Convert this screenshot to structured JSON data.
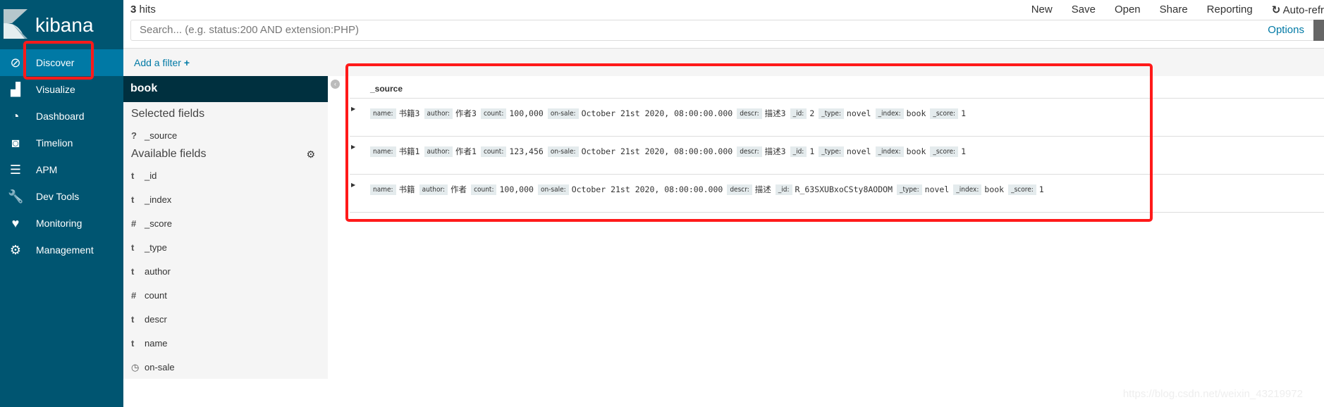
{
  "app": {
    "logo_text": "kibana"
  },
  "sidebar": {
    "items": [
      {
        "label": "Discover",
        "icon": "compass-icon",
        "active": true
      },
      {
        "label": "Visualize",
        "icon": "bar-chart-icon"
      },
      {
        "label": "Dashboard",
        "icon": "dashboard-icon"
      },
      {
        "label": "Timelion",
        "icon": "timelion-icon"
      },
      {
        "label": "APM",
        "icon": "apm-icon"
      },
      {
        "label": "Dev Tools",
        "icon": "wrench-icon"
      },
      {
        "label": "Monitoring",
        "icon": "heartbeat-icon"
      },
      {
        "label": "Management",
        "icon": "gear-icon"
      }
    ]
  },
  "topbar": {
    "hits_count": "3",
    "hits_label": " hits",
    "menu": [
      "New",
      "Save",
      "Open",
      "Share",
      "Reporting",
      "Auto-refr"
    ],
    "search_placeholder": "Search... (e.g. status:200 AND extension:PHP)",
    "options": "Options"
  },
  "filter": {
    "add_label": "Add a filter",
    "plus": "+"
  },
  "fields_panel": {
    "index": "book",
    "selected_title": "Selected fields",
    "selected": [
      {
        "type": "?",
        "name": "_source"
      }
    ],
    "available_title": "Available fields",
    "available": [
      {
        "type": "t",
        "name": "_id"
      },
      {
        "type": "t",
        "name": "_index"
      },
      {
        "type": "#",
        "name": "_score"
      },
      {
        "type": "t",
        "name": "_type"
      },
      {
        "type": "t",
        "name": "author"
      },
      {
        "type": "#",
        "name": "count"
      },
      {
        "type": "t",
        "name": "descr"
      },
      {
        "type": "t",
        "name": "name"
      },
      {
        "type": "clock",
        "name": "on-sale"
      }
    ]
  },
  "table": {
    "header": "_source",
    "rows": [
      [
        [
          "name:",
          "书籍3"
        ],
        [
          "author:",
          "作者3"
        ],
        [
          "count:",
          "100,000"
        ],
        [
          "on-sale:",
          "October 21st 2020, 08:00:00.000"
        ],
        [
          "descr:",
          "描述3"
        ],
        [
          "_id:",
          "2"
        ],
        [
          "_type:",
          "novel"
        ],
        [
          "_index:",
          "book"
        ],
        [
          "_score:",
          "1"
        ]
      ],
      [
        [
          "name:",
          "书籍1"
        ],
        [
          "author:",
          "作者1"
        ],
        [
          "count:",
          "123,456"
        ],
        [
          "on-sale:",
          "October 21st 2020, 08:00:00.000"
        ],
        [
          "descr:",
          "描述3"
        ],
        [
          "_id:",
          "1"
        ],
        [
          "_type:",
          "novel"
        ],
        [
          "_index:",
          "book"
        ],
        [
          "_score:",
          "1"
        ]
      ],
      [
        [
          "name:",
          "书籍"
        ],
        [
          "author:",
          "作者"
        ],
        [
          "count:",
          "100,000"
        ],
        [
          "on-sale:",
          "October 21st 2020, 08:00:00.000"
        ],
        [
          "descr:",
          "描述"
        ],
        [
          "_id:",
          "R_63SXUBxoCSty8AODOM"
        ],
        [
          "_type:",
          "novel"
        ],
        [
          "_index:",
          "book"
        ],
        [
          "_score:",
          "1"
        ]
      ]
    ]
  },
  "watermark": "https://blog.csdn.net/weixin_43219972",
  "colors": {
    "sidebar": "#005571",
    "active": "#0079a5",
    "index_header": "#00303f",
    "annotation": "#ff1a1a"
  }
}
